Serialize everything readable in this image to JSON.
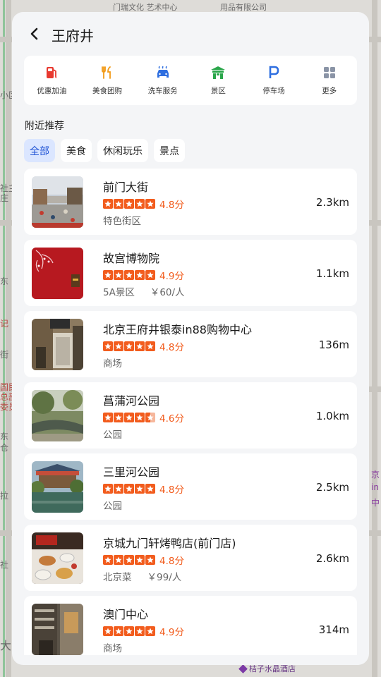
{
  "map": {
    "top_labels": [
      "门瑞文化\n艺术中心",
      "用品有限公司"
    ],
    "left_labels": [
      "小区",
      "社主",
      "庄",
      "东",
      "记",
      "街",
      "国民",
      "总部",
      "委员",
      "东",
      "仓",
      "拉",
      "社",
      "大"
    ],
    "right_labels": [
      "京",
      "in",
      "中"
    ],
    "bottom_label": "桔子水晶酒店"
  },
  "header": {
    "back_icon": "chevron-left-icon",
    "title": "王府井"
  },
  "quick_actions": [
    {
      "label": "优惠加油",
      "icon": "fuel-icon",
      "color": "#e8392f"
    },
    {
      "label": "美食团购",
      "icon": "food-icon",
      "color": "#f29a16"
    },
    {
      "label": "洗车服务",
      "icon": "car-wash-icon",
      "color": "#2f6fe0"
    },
    {
      "label": "景区",
      "icon": "scenic-icon",
      "color": "#2aa64a"
    },
    {
      "label": "停车场",
      "icon": "parking-icon",
      "color": "#2f6fe0"
    },
    {
      "label": "更多",
      "icon": "more-grid-icon",
      "color": "#8a94a6"
    }
  ],
  "section": {
    "title": "附近推荐"
  },
  "filters": [
    {
      "label": "全部",
      "active": true
    },
    {
      "label": "美食",
      "active": false
    },
    {
      "label": "休闲玩乐",
      "active": false
    },
    {
      "label": "景点",
      "active": false
    }
  ],
  "places": [
    {
      "name": "前门大街",
      "rating": 4.8,
      "score_text": "4.8分",
      "stars": 5,
      "category": "特色街区",
      "price": "",
      "distance": "2.3km"
    },
    {
      "name": "故宫博物院",
      "rating": 4.9,
      "score_text": "4.9分",
      "stars": 5,
      "category": "5A景区",
      "price": "￥60/人",
      "distance": "1.1km"
    },
    {
      "name": "北京王府井银泰in88购物中心",
      "rating": 4.8,
      "score_text": "4.8分",
      "stars": 5,
      "category": "商场",
      "price": "",
      "distance": "136m"
    },
    {
      "name": "菖蒲河公园",
      "rating": 4.6,
      "score_text": "4.6分",
      "stars": 4.5,
      "category": "公园",
      "price": "",
      "distance": "1.0km"
    },
    {
      "name": "三里河公园",
      "rating": 4.8,
      "score_text": "4.8分",
      "stars": 5,
      "category": "公园",
      "price": "",
      "distance": "2.5km"
    },
    {
      "name": "京城九门轩烤鸭店(前门店)",
      "rating": 4.8,
      "score_text": "4.8分",
      "stars": 5,
      "category": "北京菜",
      "price": "￥99/人",
      "distance": "2.6km"
    },
    {
      "name": "澳门中心",
      "rating": 4.9,
      "score_text": "4.9分",
      "stars": 5,
      "category": "商场",
      "price": "",
      "distance": "314m"
    }
  ]
}
